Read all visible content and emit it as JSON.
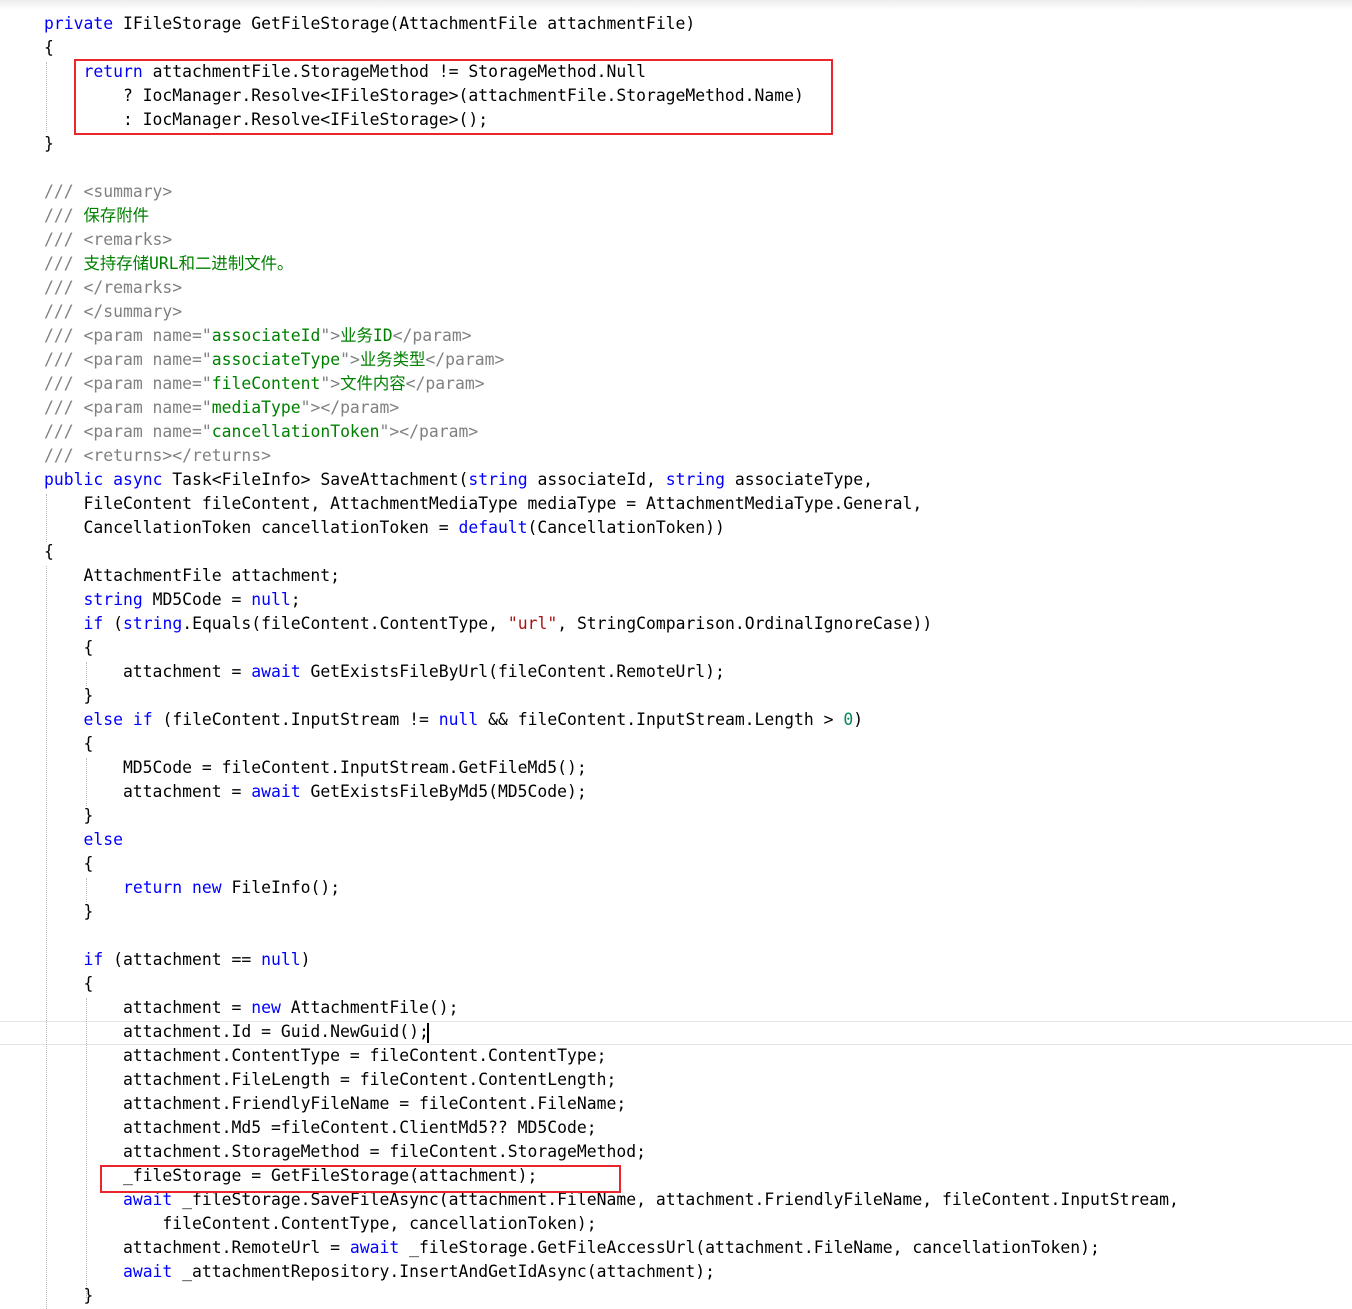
{
  "code": {
    "lines": [
      [
        {
          "t": "private",
          "c": "kw"
        },
        {
          "t": " IFileStorage GetFileStorage(AttachmentFile attachmentFile)"
        }
      ],
      [
        {
          "t": "{"
        }
      ],
      [
        {
          "t": "    "
        },
        {
          "t": "return",
          "c": "kw"
        },
        {
          "t": " attachmentFile.StorageMethod != StorageMethod.Null"
        }
      ],
      [
        {
          "t": "        ? IocManager.Resolve<IFileStorage>(attachmentFile.StorageMethod.Name)"
        }
      ],
      [
        {
          "t": "        : IocManager.Resolve<IFileStorage>();"
        }
      ],
      [
        {
          "t": "}"
        }
      ],
      [],
      [
        {
          "t": "/// ",
          "c": "tg"
        },
        {
          "t": "<summary>",
          "c": "tg"
        }
      ],
      [
        {
          "t": "///",
          "c": "tg"
        },
        {
          "t": " 保存附件",
          "c": "cm"
        }
      ],
      [
        {
          "t": "/// ",
          "c": "tg"
        },
        {
          "t": "<remarks>",
          "c": "tg"
        }
      ],
      [
        {
          "t": "///",
          "c": "tg"
        },
        {
          "t": " 支持存储URL和二进制文件。",
          "c": "cm"
        }
      ],
      [
        {
          "t": "/// ",
          "c": "tg"
        },
        {
          "t": "</remarks>",
          "c": "tg"
        }
      ],
      [
        {
          "t": "/// ",
          "c": "tg"
        },
        {
          "t": "</summary>",
          "c": "tg"
        }
      ],
      [
        {
          "t": "/// ",
          "c": "tg"
        },
        {
          "t": "<param name=\"",
          "c": "tg"
        },
        {
          "t": "associateId",
          "c": "cm"
        },
        {
          "t": "\">",
          "c": "tg"
        },
        {
          "t": "业务ID",
          "c": "cm"
        },
        {
          "t": "</param>",
          "c": "tg"
        }
      ],
      [
        {
          "t": "/// ",
          "c": "tg"
        },
        {
          "t": "<param name=\"",
          "c": "tg"
        },
        {
          "t": "associateType",
          "c": "cm"
        },
        {
          "t": "\">",
          "c": "tg"
        },
        {
          "t": "业务类型",
          "c": "cm"
        },
        {
          "t": "</param>",
          "c": "tg"
        }
      ],
      [
        {
          "t": "/// ",
          "c": "tg"
        },
        {
          "t": "<param name=\"",
          "c": "tg"
        },
        {
          "t": "fileContent",
          "c": "cm"
        },
        {
          "t": "\">",
          "c": "tg"
        },
        {
          "t": "文件内容",
          "c": "cm"
        },
        {
          "t": "</param>",
          "c": "tg"
        }
      ],
      [
        {
          "t": "/// ",
          "c": "tg"
        },
        {
          "t": "<param name=\"",
          "c": "tg"
        },
        {
          "t": "mediaType",
          "c": "cm"
        },
        {
          "t": "\"></param>",
          "c": "tg"
        }
      ],
      [
        {
          "t": "/// ",
          "c": "tg"
        },
        {
          "t": "<param name=\"",
          "c": "tg"
        },
        {
          "t": "cancellationToken",
          "c": "cm"
        },
        {
          "t": "\"></param>",
          "c": "tg"
        }
      ],
      [
        {
          "t": "/// ",
          "c": "tg"
        },
        {
          "t": "<returns></returns>",
          "c": "tg"
        }
      ],
      [
        {
          "t": "public",
          "c": "kw"
        },
        {
          "t": " "
        },
        {
          "t": "async",
          "c": "kw"
        },
        {
          "t": " Task<FileInfo> SaveAttachment("
        },
        {
          "t": "string",
          "c": "kw"
        },
        {
          "t": " associateId, "
        },
        {
          "t": "string",
          "c": "kw"
        },
        {
          "t": " associateType,"
        }
      ],
      [
        {
          "t": "    FileContent fileContent, AttachmentMediaType mediaType = AttachmentMediaType.General,"
        }
      ],
      [
        {
          "t": "    CancellationToken cancellationToken = "
        },
        {
          "t": "default",
          "c": "kw"
        },
        {
          "t": "(CancellationToken))"
        }
      ],
      [
        {
          "t": "{"
        }
      ],
      [
        {
          "t": "    AttachmentFile attachment;"
        }
      ],
      [
        {
          "t": "    "
        },
        {
          "t": "string",
          "c": "kw"
        },
        {
          "t": " MD5Code = "
        },
        {
          "t": "null",
          "c": "kw"
        },
        {
          "t": ";"
        }
      ],
      [
        {
          "t": "    "
        },
        {
          "t": "if",
          "c": "kw"
        },
        {
          "t": " ("
        },
        {
          "t": "string",
          "c": "kw"
        },
        {
          "t": ".Equals(fileContent.ContentType, "
        },
        {
          "t": "\"url\"",
          "c": "st"
        },
        {
          "t": ", StringComparison.OrdinalIgnoreCase))"
        }
      ],
      [
        {
          "t": "    {"
        }
      ],
      [
        {
          "t": "        attachment = "
        },
        {
          "t": "await",
          "c": "kw"
        },
        {
          "t": " GetExistsFileByUrl(fileContent.RemoteUrl);"
        }
      ],
      [
        {
          "t": "    }"
        }
      ],
      [
        {
          "t": "    "
        },
        {
          "t": "else",
          "c": "kw"
        },
        {
          "t": " "
        },
        {
          "t": "if",
          "c": "kw"
        },
        {
          "t": " (fileContent.InputStream != "
        },
        {
          "t": "null",
          "c": "kw"
        },
        {
          "t": " && fileContent.InputStream.Length > "
        },
        {
          "t": "0",
          "c": "nm"
        },
        {
          "t": ")"
        }
      ],
      [
        {
          "t": "    {"
        }
      ],
      [
        {
          "t": "        MD5Code = fileContent.InputStream.GetFileMd5();"
        }
      ],
      [
        {
          "t": "        attachment = "
        },
        {
          "t": "await",
          "c": "kw"
        },
        {
          "t": " GetExistsFileByMd5(MD5Code);"
        }
      ],
      [
        {
          "t": "    }"
        }
      ],
      [
        {
          "t": "    "
        },
        {
          "t": "else",
          "c": "kw"
        }
      ],
      [
        {
          "t": "    {"
        }
      ],
      [
        {
          "t": "        "
        },
        {
          "t": "return",
          "c": "kw"
        },
        {
          "t": " "
        },
        {
          "t": "new",
          "c": "kw"
        },
        {
          "t": " FileInfo();"
        }
      ],
      [
        {
          "t": "    }"
        }
      ],
      [],
      [
        {
          "t": "    "
        },
        {
          "t": "if",
          "c": "kw"
        },
        {
          "t": " (attachment == "
        },
        {
          "t": "null",
          "c": "kw"
        },
        {
          "t": ")"
        }
      ],
      [
        {
          "t": "    {"
        }
      ],
      [
        {
          "t": "        attachment = "
        },
        {
          "t": "new",
          "c": "kw"
        },
        {
          "t": " AttachmentFile();"
        }
      ],
      [
        {
          "t": "        attachment.Id = Guid.NewGuid();"
        }
      ],
      [
        {
          "t": "        attachment.ContentType = fileContent.ContentType;"
        }
      ],
      [
        {
          "t": "        attachment.FileLength = fileContent.ContentLength;"
        }
      ],
      [
        {
          "t": "        attachment.FriendlyFileName = fileContent.FileName;"
        }
      ],
      [
        {
          "t": "        attachment.Md5 =fileContent.ClientMd5?? MD5Code;"
        }
      ],
      [
        {
          "t": "        attachment.StorageMethod = fileContent.StorageMethod;"
        }
      ],
      [
        {
          "t": "        _fileStorage = GetFileStorage(attachment);"
        }
      ],
      [
        {
          "t": "        "
        },
        {
          "t": "await",
          "c": "kw"
        },
        {
          "t": " _fileStorage.SaveFileAsync(attachment.FileName, attachment.FriendlyFileName, fileContent.InputStream,"
        }
      ],
      [
        {
          "t": "            fileContent.ContentType, cancellationToken);"
        }
      ],
      [
        {
          "t": "        attachment.RemoteUrl = "
        },
        {
          "t": "await",
          "c": "kw"
        },
        {
          "t": " _fileStorage.GetFileAccessUrl(attachment.FileName, cancellationToken);"
        }
      ],
      [
        {
          "t": "        "
        },
        {
          "t": "await",
          "c": "kw"
        },
        {
          "t": " _attachmentRepository.InsertAndGetIdAsync(attachment);"
        }
      ],
      [
        {
          "t": "    }"
        }
      ]
    ]
  }
}
